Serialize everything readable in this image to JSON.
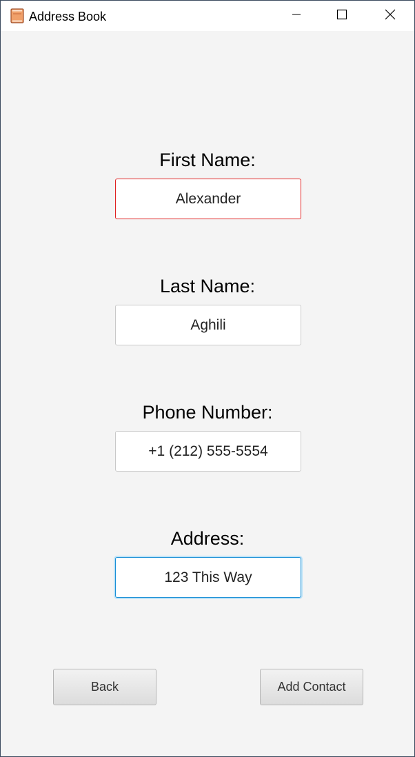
{
  "window": {
    "title": "Address Book",
    "icon": "address-book-icon",
    "controls": [
      "minimize-icon",
      "maximize-icon",
      "close-icon"
    ]
  },
  "form": {
    "first_name": {
      "label": "First Name:",
      "value": "Alexander",
      "state": "error"
    },
    "last_name": {
      "label": "Last Name:",
      "value": "Aghili"
    },
    "phone": {
      "label": "Phone Number:",
      "value": "+1 (212) 555-5554"
    },
    "address": {
      "label": "Address:",
      "value": "123 This Way",
      "state": "focused"
    }
  },
  "buttons": {
    "back_label": "Back",
    "add_label": "Add Contact"
  },
  "colors": {
    "error_border": "#e02222",
    "focus_border": "#1a8fd6",
    "background": "#f4f4f4"
  }
}
